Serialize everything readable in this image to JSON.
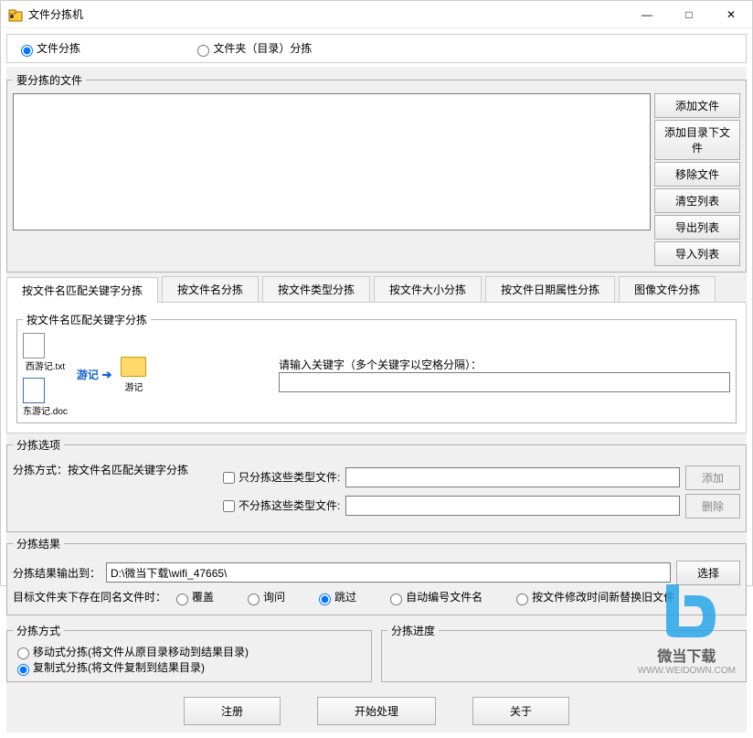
{
  "window": {
    "title": "文件分拣机",
    "minimize": "—",
    "maximize": "□",
    "close": "✕"
  },
  "modes": {
    "file_sort": "文件分拣",
    "folder_sort": "文件夹（目录）分拣"
  },
  "files_section": {
    "legend": "要分拣的文件",
    "btn_add_file": "添加文件",
    "btn_add_dir": "添加目录下文件",
    "btn_remove": "移除文件",
    "btn_clear": "清空列表",
    "btn_export": "导出列表",
    "btn_import": "导入列表"
  },
  "tabs": {
    "t1": "按文件名匹配关键字分拣",
    "t2": "按文件名分拣",
    "t3": "按文件类型分拣",
    "t4": "按文件大小分拣",
    "t5": "按文件日期属性分拣",
    "t6": "图像文件分拣"
  },
  "tab_panel": {
    "inner_legend": "按文件名匹配关键字分拣",
    "file1": "西游记.txt",
    "file2": "东游记.doc",
    "keyword_arrow": "游记",
    "folder_label": "游记",
    "keyword_prompt": "请输入关键字（多个关键字以空格分隔）："
  },
  "sort_options": {
    "legend": "分拣选项",
    "method_label": "分拣方式：按文件名匹配关键字分拣",
    "only_types": "只分拣这些类型文件:",
    "exclude_types": "不分拣这些类型文件:",
    "btn_add": "添加",
    "btn_del": "删除"
  },
  "sort_result": {
    "legend": "分拣结果",
    "output_label": "分拣结果输出到：",
    "output_path": "D:\\微当下载\\wifi_47665\\",
    "btn_select": "选择",
    "dup_label": "目标文件夹下存在同名文件时：",
    "opt_overwrite": "覆盖",
    "opt_ask": "询问",
    "opt_skip": "跳过",
    "opt_autonum": "自动编号文件名",
    "opt_replace": "按文件修改时间新替换旧文件"
  },
  "sort_mode": {
    "legend": "分拣方式",
    "opt_move": "移动式分拣(将文件从原目录移动到结果目录)",
    "opt_copy": "复制式分拣(将文件复制到结果目录)"
  },
  "progress": {
    "legend": "分拣进度"
  },
  "bottom": {
    "register": "注册",
    "start": "开始处理",
    "about": "关于"
  },
  "watermark": {
    "text1": "微当下载",
    "text2": "WWW.WEIDOWN.COM"
  }
}
